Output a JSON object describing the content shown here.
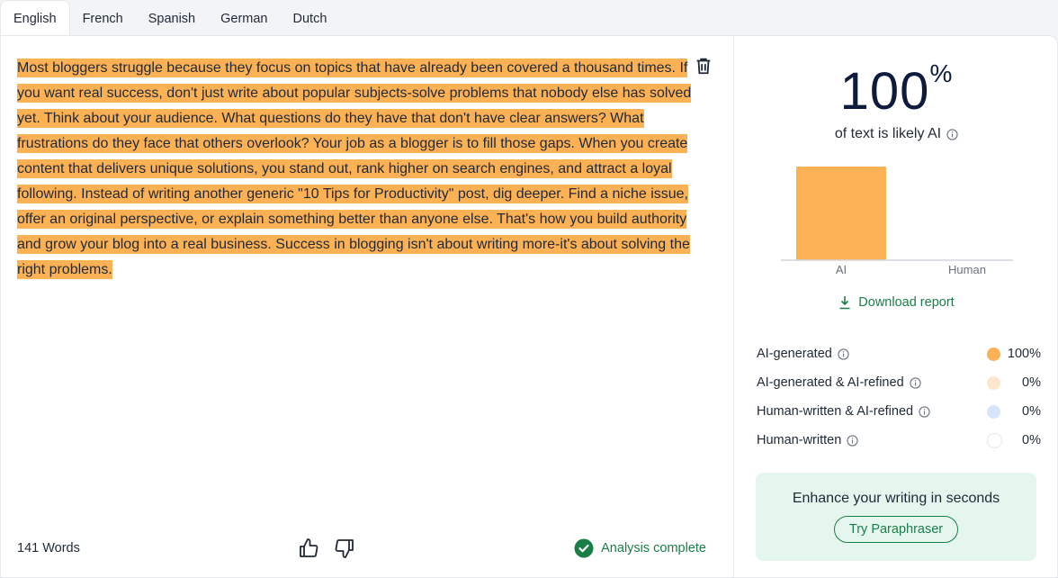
{
  "tabs": [
    "English",
    "French",
    "Spanish",
    "German",
    "Dutch"
  ],
  "input_text": "Most bloggers struggle because they focus on topics that have already been covered a thousand times. If you want real success, don't just write about popular subjects-solve problems that nobody else has solved yet. Think about your audience. What questions do they have that don't have clear answers? What frustrations do they face that others overlook? Your job as a blogger is to fill those gaps. When you create content that delivers unique solutions, you stand out, rank higher on search engines, and attract a loyal following. Instead of writing another generic \"10 Tips for Productivity\" post, dig deeper. Find a niche issue, offer an original perspective, or explain something better than anyone else. That's how you build authority and grow your blog into a real business. Success in blogging isn't about writing more-it's about solving the right problems.",
  "footer": {
    "word_count": "141 Words",
    "status": "Analysis complete"
  },
  "result": {
    "percent": "100",
    "percent_sign": "%",
    "subtitle": "of text is likely AI",
    "download_label": "Download report"
  },
  "chart_data": {
    "type": "bar",
    "categories": [
      "AI",
      "Human"
    ],
    "values": [
      100,
      0
    ],
    "ylim": [
      0,
      100
    ],
    "colors": [
      "#fdb155",
      "#dbeafe"
    ]
  },
  "breakdown": [
    {
      "label": "AI-generated",
      "value": "100%",
      "color": "#fdb155"
    },
    {
      "label": "AI-generated & AI-refined",
      "value": "0%",
      "color": "#fde6cc"
    },
    {
      "label": "Human-written & AI-refined",
      "value": "0%",
      "color": "#d6e4fb"
    },
    {
      "label": "Human-written",
      "value": "0%",
      "color": "#ffffff"
    }
  ],
  "promo": {
    "title": "Enhance your writing in seconds",
    "button": "Try Paraphraser"
  },
  "colors": {
    "highlight": "#fdb155",
    "accent_green": "#1a7f47"
  }
}
